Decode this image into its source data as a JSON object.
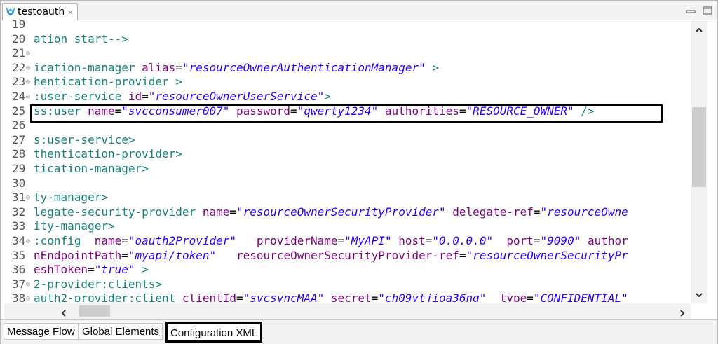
{
  "editor": {
    "tab_title": "testoauth",
    "tab_close": "×",
    "tab_icon": "mule-icon"
  },
  "code_lines": [
    {
      "n": "19",
      "fold": "",
      "parts": []
    },
    {
      "n": "20",
      "fold": "",
      "parts": [
        {
          "c": "pl",
          "t": "ation start-->"
        }
      ]
    },
    {
      "n": "21",
      "fold": "⊖",
      "parts": []
    },
    {
      "n": "22",
      "fold": "⊖",
      "parts": [
        {
          "c": "tg",
          "t": "ication-manager "
        },
        {
          "c": "an",
          "t": "alias"
        },
        {
          "c": "eq",
          "t": "="
        },
        {
          "c": "av",
          "t": "\"resourceOwnerAuthenticationManager\""
        },
        {
          "c": "tg",
          "t": " >"
        }
      ]
    },
    {
      "n": "23",
      "fold": "⊖",
      "parts": [
        {
          "c": "tg",
          "t": "hentication-provider >"
        }
      ]
    },
    {
      "n": "24",
      "fold": "⊖",
      "parts": [
        {
          "c": "tg",
          "t": ":user-service "
        },
        {
          "c": "an",
          "t": "id"
        },
        {
          "c": "eq",
          "t": "="
        },
        {
          "c": "av",
          "t": "\"resourceOwnerUserService\""
        },
        {
          "c": "tg",
          "t": ">"
        }
      ]
    },
    {
      "n": "25",
      "fold": "",
      "parts": [
        {
          "c": "tg",
          "t": "ss:user "
        },
        {
          "c": "an",
          "t": "name"
        },
        {
          "c": "eq",
          "t": "="
        },
        {
          "c": "av",
          "t": "\"svcconsumer007\""
        },
        {
          "c": "tg",
          "t": " "
        },
        {
          "c": "an",
          "t": "password"
        },
        {
          "c": "eq",
          "t": "="
        },
        {
          "c": "av",
          "t": "\"qwerty1234\""
        },
        {
          "c": "tg",
          "t": " "
        },
        {
          "c": "an",
          "t": "authorities"
        },
        {
          "c": "eq",
          "t": "="
        },
        {
          "c": "av",
          "t": "\"RESOURCE_OWNER\""
        },
        {
          "c": "tg",
          "t": " />"
        }
      ]
    },
    {
      "n": "26",
      "fold": "",
      "parts": []
    },
    {
      "n": "27",
      "fold": "",
      "parts": [
        {
          "c": "tg",
          "t": "s:user-service>"
        }
      ]
    },
    {
      "n": "28",
      "fold": "",
      "parts": [
        {
          "c": "tg",
          "t": "thentication-provider>"
        }
      ]
    },
    {
      "n": "29",
      "fold": "",
      "parts": [
        {
          "c": "tg",
          "t": "tication-manager>"
        }
      ]
    },
    {
      "n": "30",
      "fold": "",
      "parts": []
    },
    {
      "n": "31",
      "fold": "⊖",
      "parts": [
        {
          "c": "tg",
          "t": "ty-manager>"
        }
      ]
    },
    {
      "n": "32",
      "fold": "",
      "parts": [
        {
          "c": "tg",
          "t": "legate-security-provider "
        },
        {
          "c": "an",
          "t": "name"
        },
        {
          "c": "eq",
          "t": "="
        },
        {
          "c": "av",
          "t": "\"resourceOwnerSecurityProvider\""
        },
        {
          "c": "tg",
          "t": " "
        },
        {
          "c": "an",
          "t": "delegate-ref"
        },
        {
          "c": "eq",
          "t": "="
        },
        {
          "c": "av",
          "t": "\"resourceOwne"
        }
      ]
    },
    {
      "n": "33",
      "fold": "",
      "parts": [
        {
          "c": "tg",
          "t": "ity-manager>"
        }
      ]
    },
    {
      "n": "34",
      "fold": "⊖",
      "parts": [
        {
          "c": "tg",
          "t": ":config  "
        },
        {
          "c": "an",
          "t": "name"
        },
        {
          "c": "eq",
          "t": "="
        },
        {
          "c": "av",
          "t": "\"oauth2Provider\""
        },
        {
          "c": "tg",
          "t": "   "
        },
        {
          "c": "an",
          "t": "providerName"
        },
        {
          "c": "eq",
          "t": "="
        },
        {
          "c": "av",
          "t": "\"MyAPI\""
        },
        {
          "c": "tg",
          "t": " "
        },
        {
          "c": "an",
          "t": "host"
        },
        {
          "c": "eq",
          "t": "="
        },
        {
          "c": "av",
          "t": "\"0.0.0.0\""
        },
        {
          "c": "tg",
          "t": "  "
        },
        {
          "c": "an",
          "t": "port"
        },
        {
          "c": "eq",
          "t": "="
        },
        {
          "c": "av",
          "t": "\"9090\""
        },
        {
          "c": "tg",
          "t": " "
        },
        {
          "c": "an",
          "t": "author"
        }
      ]
    },
    {
      "n": "35",
      "fold": "",
      "parts": [
        {
          "c": "an",
          "t": "nEndpointPath"
        },
        {
          "c": "eq",
          "t": "="
        },
        {
          "c": "av",
          "t": "\"myapi/token\""
        },
        {
          "c": "tg",
          "t": "   "
        },
        {
          "c": "an",
          "t": "resourceOwnerSecurityProvider-ref"
        },
        {
          "c": "eq",
          "t": "="
        },
        {
          "c": "av",
          "t": "\"resourceOwnerSecurityPr"
        }
      ]
    },
    {
      "n": "36",
      "fold": "",
      "parts": [
        {
          "c": "an",
          "t": "eshToken"
        },
        {
          "c": "eq",
          "t": "="
        },
        {
          "c": "av",
          "t": "\"true\""
        },
        {
          "c": "tg",
          "t": " >"
        }
      ]
    },
    {
      "n": "37",
      "fold": "⊖",
      "parts": [
        {
          "c": "tg",
          "t": "2-provider:clients>"
        }
      ]
    },
    {
      "n": "38",
      "fold": "⊖",
      "parts": [
        {
          "c": "tg",
          "t": "auth2-provider:client "
        },
        {
          "c": "an",
          "t": "clientId"
        },
        {
          "c": "eq",
          "t": "="
        },
        {
          "c": "av",
          "t": "\"svcsyncMAA\""
        },
        {
          "c": "tg",
          "t": " "
        },
        {
          "c": "an",
          "t": "secret"
        },
        {
          "c": "eq",
          "t": "="
        },
        {
          "c": "av",
          "t": "\"ch09ytjioa36nq\""
        },
        {
          "c": "tg",
          "t": "  "
        },
        {
          "c": "an",
          "t": "type"
        },
        {
          "c": "eq",
          "t": "="
        },
        {
          "c": "av",
          "t": "\"CONFIDENTIAL\""
        }
      ]
    }
  ],
  "bottom_tabs": {
    "message_flow": "Message Flow",
    "global_elements": "Global Elements",
    "configuration_xml": "Configuration XML"
  },
  "colors": {
    "tag": "#17837b",
    "attribute_name": "#7f007f",
    "attribute_value": "#2a00ff",
    "highlight_border": "#000000"
  }
}
